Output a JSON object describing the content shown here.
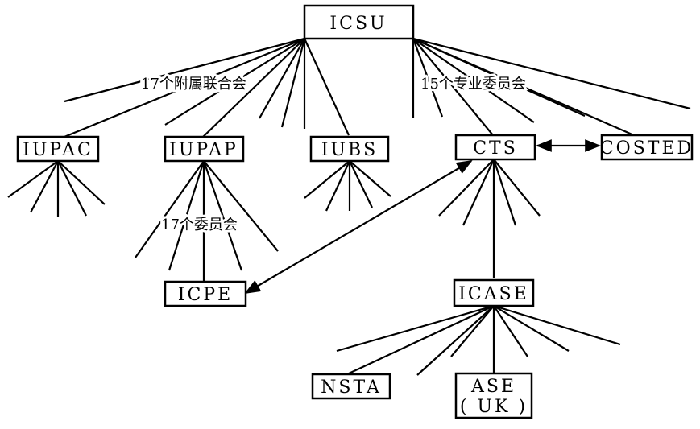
{
  "nodes": {
    "icsu": "ICSU",
    "iupac": "IUPAC",
    "iupap": "IUPAP",
    "iubs": "IUBS",
    "cts": "CTS",
    "costed": "COSTED",
    "icpe": "ICPE",
    "icase": "ICASE",
    "nsta": "NSTA",
    "ase_line1": "ASE",
    "ase_line2": "( UK )"
  },
  "labels": {
    "unions": "17个附属联合会",
    "committees": "15个专业委员会",
    "iupap_commissions": "17个委员会"
  },
  "colors": {
    "stroke": "#000000",
    "background": "#ffffff"
  }
}
